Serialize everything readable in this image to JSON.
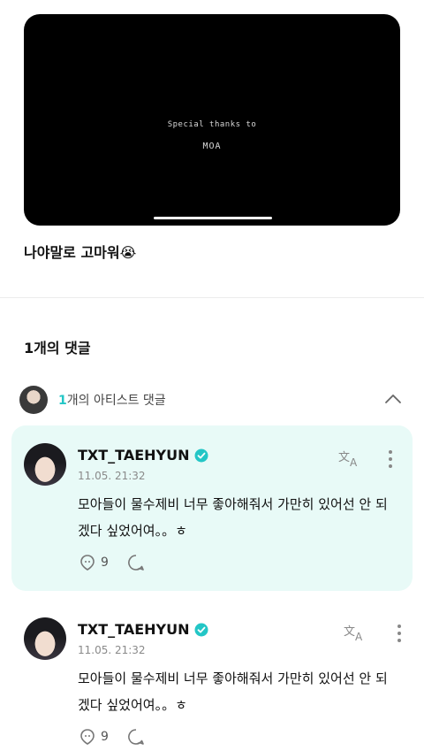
{
  "video": {
    "line1": "Special thanks to",
    "line2": "MOA"
  },
  "post": {
    "text": "나야말로 고마워😭"
  },
  "comments_section": {
    "count_label": "1개의 댓글"
  },
  "artist_comments": {
    "count": "1",
    "label": "개의 아티스트 댓글"
  },
  "comments": [
    {
      "author": "TXT_TAEHYUN",
      "time": "11.05. 21:32",
      "body": "모아들이 물수제비 너무 좋아해줘서 가만히 있어선 안 되겠다 싶었어여。。ㅎ",
      "likes": "9"
    },
    {
      "author": "TXT_TAEHYUN",
      "time": "11.05. 21:32",
      "body": "모아들이 물수제비 너무 좋아해줘서 가만히 있어선 안 되겠다 싶었어여。。ㅎ",
      "likes": "9"
    }
  ],
  "colors": {
    "accent": "#23c6c6",
    "highlight_bg": "#e8faf7"
  }
}
